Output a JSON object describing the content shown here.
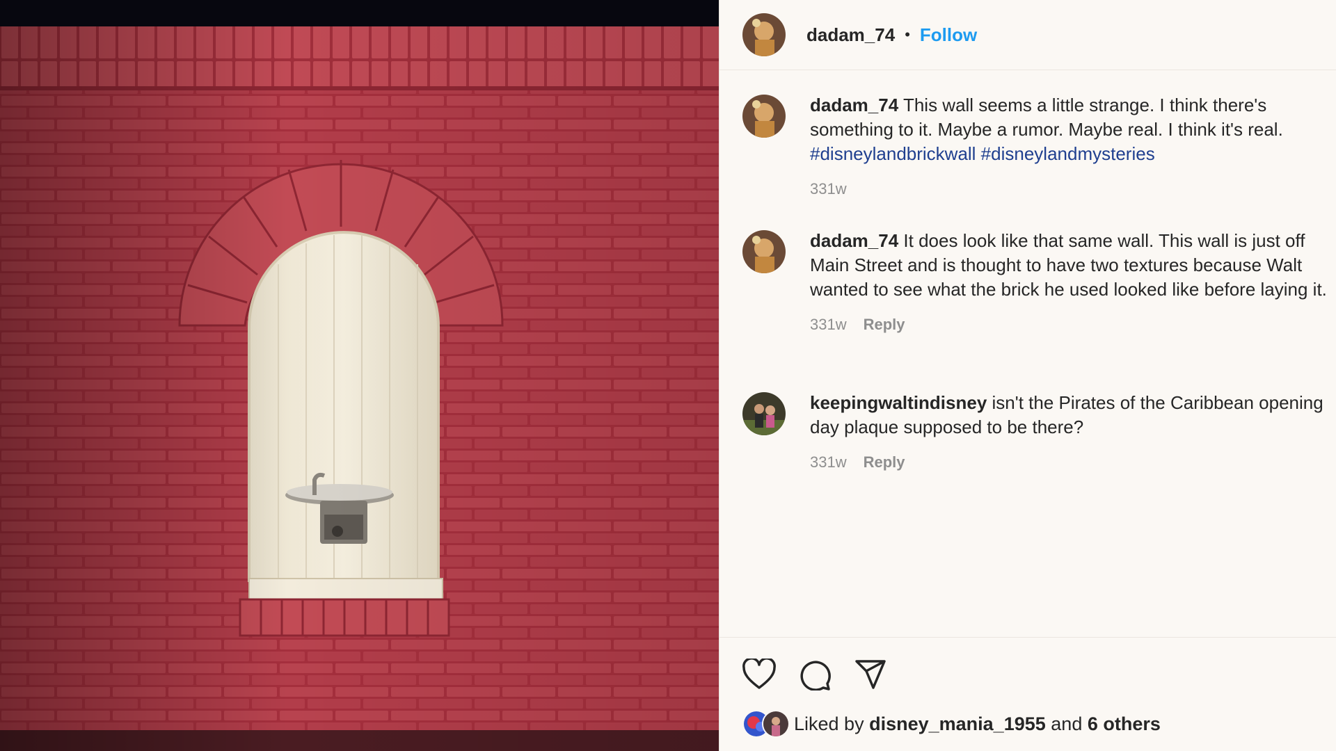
{
  "post": {
    "image_alt": "Red brick wall with arched alcove and drinking fountain",
    "author": "dadam_74",
    "separator": "•",
    "follow_label": "Follow"
  },
  "comments": [
    {
      "user": "dadam_74",
      "text": "This wall seems a little strange. I think there's something to it. Maybe a rumor. Maybe real. I think it's real.",
      "hashtags": "#disneylandbrickwall #disneylandmysteries",
      "time": "331w"
    },
    {
      "user": "dadam_74",
      "text": "It does look like that same wall. This wall is just off Main Street and is thought to have two textures because Walt wanted to see what the brick he used looked like before laying it.",
      "time": "331w",
      "reply": "Reply"
    },
    {
      "user": "keepingwaltindisney",
      "text": "isn't the Pirates of the Caribbean opening day plaque supposed to be there?",
      "time": "331w",
      "reply": "Reply"
    }
  ],
  "likes": {
    "prefix": "Liked by",
    "user": "disney_mania_1955",
    "joiner": "and",
    "others": "6 others"
  },
  "icons": [
    "heart-icon",
    "comment-icon",
    "share-icon"
  ],
  "colors": {
    "brick": "#b03a48",
    "follow": "#1d9bf0",
    "hashtag": "#1f3f8f",
    "meta": "#8e8e8e"
  }
}
